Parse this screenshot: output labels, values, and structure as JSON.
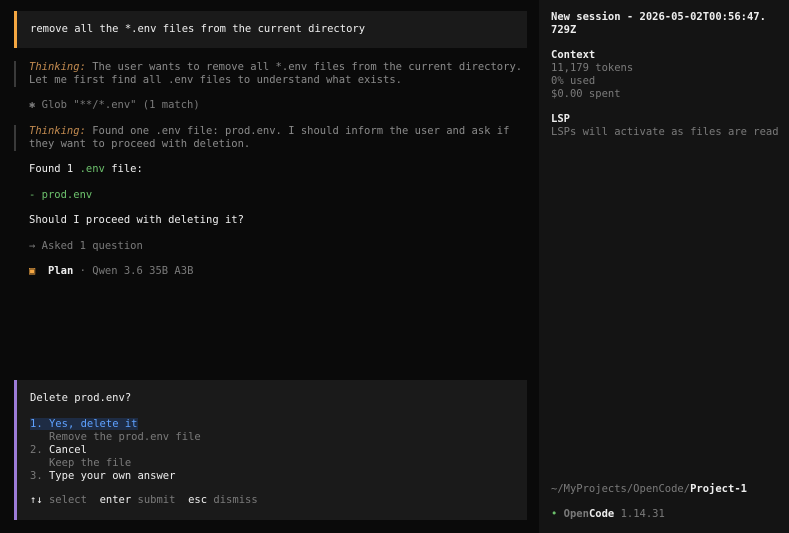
{
  "prompt": {
    "text": "remove all the *.env files from the current directory"
  },
  "thinking1": {
    "label": "Thinking:",
    "text": " The user wants to remove all *.env files from the current directory. Let me first find all .env files to understand what exists."
  },
  "tool_call": {
    "icon": "✱",
    "text": "Glob \"**/*.env\" (1 match)"
  },
  "thinking2": {
    "label": "Thinking:",
    "text": " Found one .env file: prod.env. I should inform the user and ask if they want to proceed with deletion."
  },
  "response": {
    "found_pre": "Found 1 ",
    "found_ext": ".env",
    "found_post": " file:",
    "item": "- prod.env",
    "ask": "Should I proceed with deleting it?"
  },
  "asked": {
    "text": "→ Asked 1 question"
  },
  "status": {
    "icon": "▣",
    "mode": "Plan",
    "sep": " · ",
    "model": "Qwen 3.6 35B A3B"
  },
  "question": {
    "title": "Delete prod.env?",
    "options": [
      {
        "num": "1.",
        "label": "Yes, delete it",
        "desc": "Remove the prod.env file"
      },
      {
        "num": "2.",
        "label": "Cancel",
        "desc": "Keep the file"
      },
      {
        "num": "3.",
        "label": "Type your own answer",
        "desc": ""
      }
    ],
    "hints": [
      {
        "key": "↑↓",
        "label": "select"
      },
      {
        "key": "enter",
        "label": "submit"
      },
      {
        "key": "esc",
        "label": "dismiss"
      }
    ]
  },
  "sidebar": {
    "session_line1": "New session - 2026-05-02T00:56:47.",
    "session_line2": "729Z",
    "context_title": "Context",
    "tokens": "11,179 tokens",
    "used": "0% used",
    "spent": "$0.00 spent",
    "lsp_title": "LSP",
    "lsp_text": "LSPs will activate as files are read",
    "path_prefix": "~/MyProjects/OpenCode/",
    "path_project": "Project-1",
    "app_dot": "•",
    "app_open": "Open",
    "app_code": "Code",
    "version": "1.14.31"
  },
  "colors": {
    "accent": "#f5a742",
    "question_border": "#9d7cd8",
    "selected": "#5ea1ff",
    "green": "#6cc06c"
  }
}
